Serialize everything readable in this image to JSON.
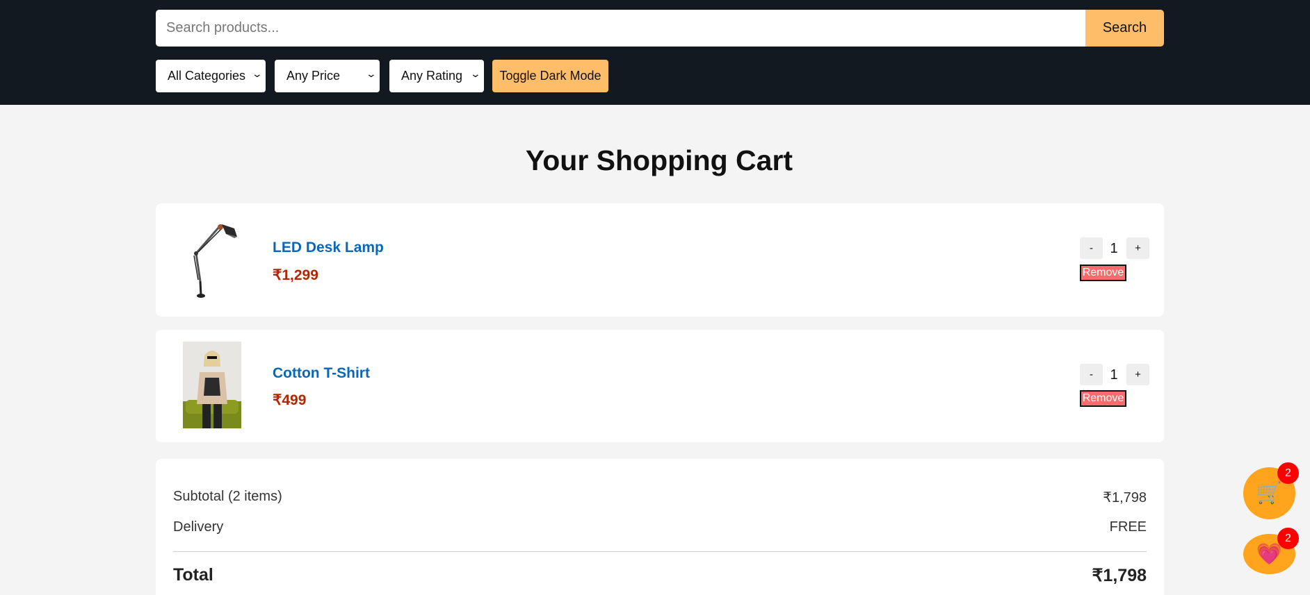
{
  "header": {
    "search_placeholder": "Search products...",
    "search_label": "Search",
    "filters": {
      "category": "All Categories",
      "price": "Any Price",
      "rating": "Any Rating"
    },
    "toggle_label": "Toggle Dark Mode"
  },
  "page_title": "Your Shopping Cart",
  "cart_items": [
    {
      "name": "LED Desk Lamp",
      "price": "₹1,299",
      "qty": "1",
      "minus": "-",
      "plus": "+",
      "remove": "Remove"
    },
    {
      "name": "Cotton T-Shirt",
      "price": "₹499",
      "qty": "1",
      "minus": "-",
      "plus": "+",
      "remove": "Remove"
    }
  ],
  "summary": {
    "subtotal_label": "Subtotal (2 items)",
    "subtotal_value": "₹1,798",
    "delivery_label": "Delivery",
    "delivery_value": "FREE",
    "total_label": "Total",
    "total_value": "₹1,798"
  },
  "floating": {
    "cart_count": "2",
    "wishlist_count": "2"
  },
  "colors": {
    "header_bg": "#131921",
    "accent": "#febd69",
    "link": "#0a67b8",
    "price": "#b12704",
    "remove": "#ff6b6b",
    "badge": "#ff0000"
  },
  "icons": {
    "cart_fab": "shopping-cart-icon",
    "wishlist_fab": "heart-icon"
  }
}
